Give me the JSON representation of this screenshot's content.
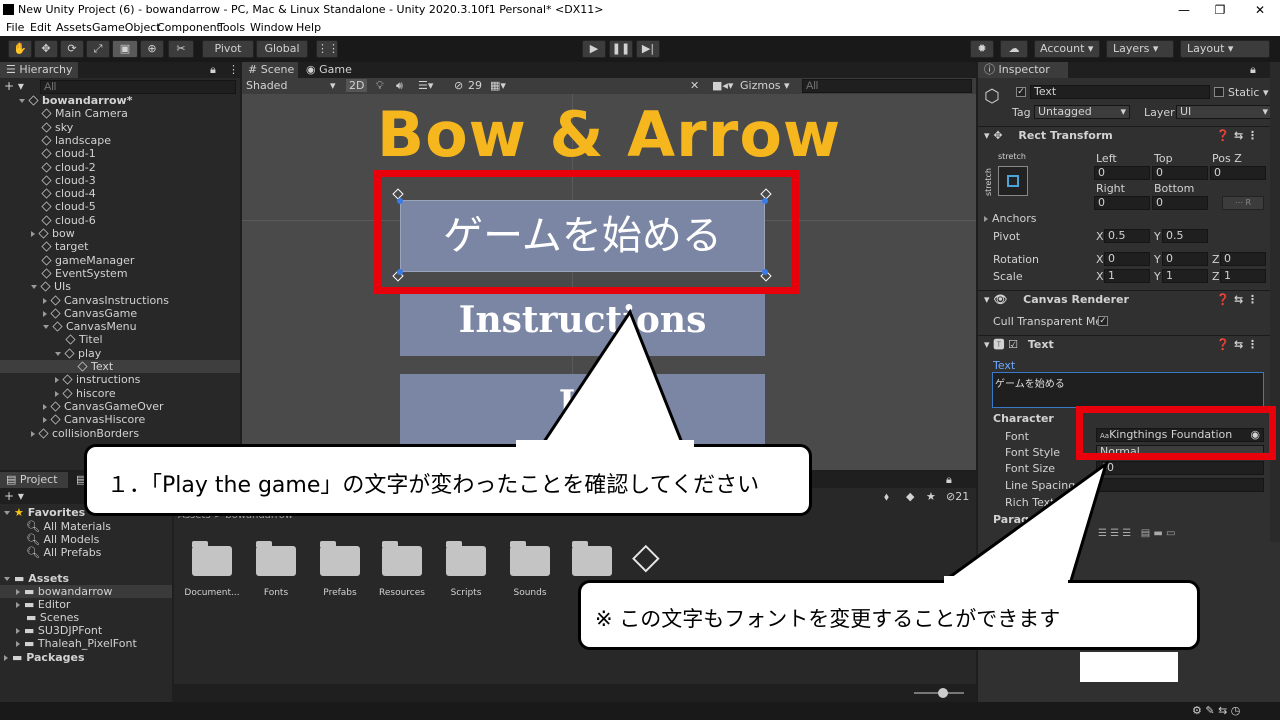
{
  "window": {
    "title": "New Unity Project (6) - bowandarrow - PC, Mac & Linux Standalone - Unity 2020.3.10f1 Personal* <DX11>",
    "minimize": "—",
    "maximize": "❐",
    "close": "✕"
  },
  "menu": [
    "File",
    "Edit",
    "Assets",
    "GameObject",
    "Component",
    "Tools",
    "Window",
    "Help"
  ],
  "toolbar": {
    "pivot": "Pivot",
    "global": "Global",
    "account": "Account",
    "layers": "Layers",
    "layout": "Layout"
  },
  "hierarchy": {
    "tab": "Hierarchy",
    "search_placeholder": "All",
    "items": [
      {
        "label": "bowandarrow*",
        "depth": 0,
        "arrow": "down",
        "bold": true
      },
      {
        "label": "Main Camera",
        "depth": 1,
        "arrow": ""
      },
      {
        "label": "sky",
        "depth": 1,
        "arrow": ""
      },
      {
        "label": "landscape",
        "depth": 1,
        "arrow": ""
      },
      {
        "label": "cloud-1",
        "depth": 1,
        "arrow": ""
      },
      {
        "label": "cloud-2",
        "depth": 1,
        "arrow": ""
      },
      {
        "label": "cloud-3",
        "depth": 1,
        "arrow": ""
      },
      {
        "label": "cloud-4",
        "depth": 1,
        "arrow": ""
      },
      {
        "label": "cloud-5",
        "depth": 1,
        "arrow": ""
      },
      {
        "label": "cloud-6",
        "depth": 1,
        "arrow": ""
      },
      {
        "label": "bow",
        "depth": 1,
        "arrow": "right"
      },
      {
        "label": "target",
        "depth": 1,
        "arrow": ""
      },
      {
        "label": "gameManager",
        "depth": 1,
        "arrow": ""
      },
      {
        "label": "EventSystem",
        "depth": 1,
        "arrow": ""
      },
      {
        "label": "UIs",
        "depth": 1,
        "arrow": "down"
      },
      {
        "label": "CanvasInstructions",
        "depth": 2,
        "arrow": "right"
      },
      {
        "label": "CanvasGame",
        "depth": 2,
        "arrow": "right"
      },
      {
        "label": "CanvasMenu",
        "depth": 2,
        "arrow": "down"
      },
      {
        "label": "Titel",
        "depth": 3,
        "arrow": ""
      },
      {
        "label": "play",
        "depth": 3,
        "arrow": "down"
      },
      {
        "label": "Text",
        "depth": 4,
        "arrow": "",
        "selected": true
      },
      {
        "label": "instructions",
        "depth": 3,
        "arrow": "right"
      },
      {
        "label": "hiscore",
        "depth": 3,
        "arrow": "right"
      },
      {
        "label": "CanvasGameOver",
        "depth": 2,
        "arrow": "right"
      },
      {
        "label": "CanvasHiscore",
        "depth": 2,
        "arrow": "right"
      },
      {
        "label": "collisionBorders",
        "depth": 1,
        "arrow": "right"
      }
    ]
  },
  "scene": {
    "tab_scene": "Scene",
    "tab_game": "Game",
    "shading": "Shaded",
    "mode_2d": "2D",
    "gizmo_count": "29",
    "gizmos": "Gizmos",
    "search_placeholder": "All",
    "game_title": "Bow & Arrow",
    "btn_play": "ゲームを始める",
    "btn_instructions": "Instructions",
    "btn_hiscore": "Hi"
  },
  "project": {
    "tab": "Project",
    "favorites": "Favorites",
    "fav_items": [
      "All Materials",
      "All Models",
      "All Prefabs"
    ],
    "assets": "Assets",
    "asset_items": [
      "bowandarrow",
      "Editor",
      "Scenes",
      "SU3DJPFont",
      "Thaleah_PixelFont"
    ],
    "packages": "Packages",
    "breadcrumb": "Assets > bowandarrow",
    "count": "21",
    "folders": [
      "Document...",
      "Fonts",
      "Prefabs",
      "Resources",
      "Scripts",
      "Sounds"
    ]
  },
  "inspector": {
    "tab": "Inspector",
    "object_name": "Text",
    "static_label": "Static",
    "tag_label": "Tag",
    "tag_value": "Untagged",
    "layer_label": "Layer",
    "layer_value": "UI",
    "rect_transform": "Rect Transform",
    "stretch": "stretch",
    "left": "Left",
    "top": "Top",
    "posz": "Pos Z",
    "left_v": "0",
    "top_v": "0",
    "posz_v": "0",
    "right": "Right",
    "bottom": "Bottom",
    "right_v": "0",
    "bottom_v": "0",
    "anchors": "Anchors",
    "pivot": "Pivot",
    "pivot_x": "0.5",
    "pivot_y": "0.5",
    "rotation": "Rotation",
    "rot_x": "0",
    "rot_y": "0",
    "rot_z": "0",
    "scale": "Scale",
    "scale_x": "1",
    "scale_y": "1",
    "scale_z": "1",
    "x": "X",
    "y": "Y",
    "z": "Z",
    "canvas_renderer": "Canvas Renderer",
    "cull": "Cull Transparent Mes",
    "text_comp": "Text",
    "text_label": "Text",
    "text_value": "ゲームを始める",
    "character": "Character",
    "font_label": "Font",
    "font_value": "Kingthings Foundation",
    "font_style_label": "Font Style",
    "font_style_value": "Normal",
    "font_size_label": "Font Size",
    "font_size_value": "40",
    "line_spacing_label": "Line Spacing",
    "rich_text_label": "Rich Text",
    "paragraph_label": "Paragra"
  },
  "callouts": {
    "step1": "１．「Play the game」の文字が変わったことを確認してください",
    "note": "※ この文字もフォントを変更することができます"
  },
  "colors": {
    "highlight": "#e8000b",
    "title_yellow": "#f5b71d",
    "button_fill": "#7b86a4"
  }
}
